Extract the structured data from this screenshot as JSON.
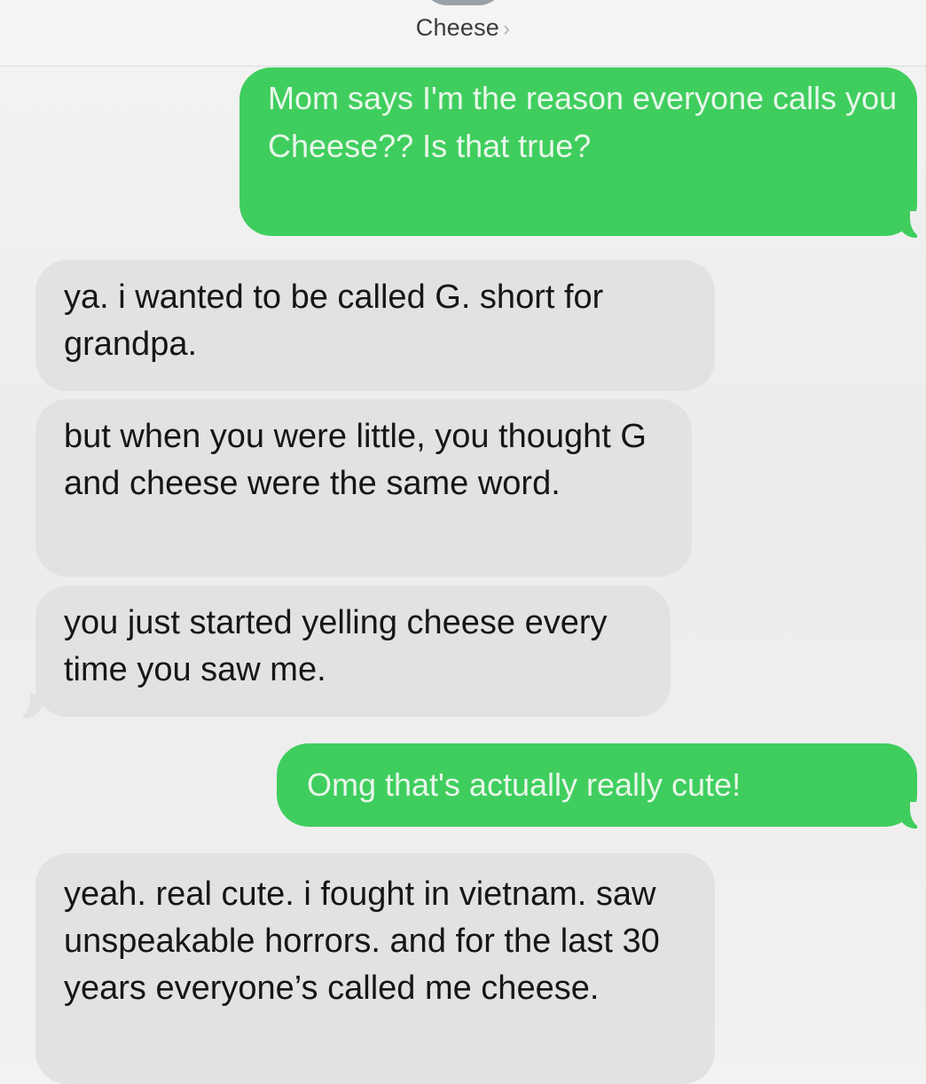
{
  "header": {
    "contact_name": "Cheese",
    "chevron": "›"
  },
  "messages": [
    {
      "direction": "sent",
      "text": "Mom says I'm the reason everyone calls you Cheese?? Is that true?"
    },
    {
      "direction": "received",
      "text": "ya. i wanted to be called G. short for grandpa."
    },
    {
      "direction": "received",
      "text": "but when you were little, you thought G and cheese were the same word."
    },
    {
      "direction": "received",
      "text": "you just started yelling cheese every time you saw me."
    },
    {
      "direction": "sent",
      "text": "Omg that's actually really cute!"
    },
    {
      "direction": "received",
      "text": "yeah. real cute. i fought in vietnam. saw unspeakable horrors. and for the last 30 years everyone’s called me cheese."
    }
  ],
  "colors": {
    "sent_bubble": "#3fce5e",
    "received_bubble": "#e2e2e4",
    "background": "#eeeeee"
  }
}
